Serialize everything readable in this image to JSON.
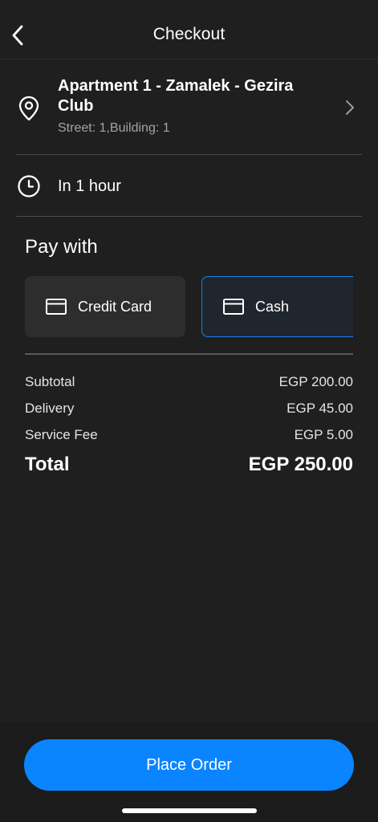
{
  "header": {
    "title": "Checkout",
    "back_icon": "chevron-left-icon"
  },
  "address": {
    "title": "Apartment 1 - Zamalek - Gezira Club",
    "subtitle": "Street: 1,Building: 1",
    "icon": "map-pin-icon",
    "action_icon": "chevron-right-icon"
  },
  "delivery_time": {
    "label": "In 1 hour",
    "icon": "clock-icon"
  },
  "payment": {
    "title": "Pay with",
    "options": [
      {
        "label": "Credit Card",
        "icon": "credit-card-icon",
        "selected": false
      },
      {
        "label": "Cash",
        "icon": "credit-card-icon",
        "selected": true
      }
    ]
  },
  "summary": {
    "rows": [
      {
        "label": "Subtotal",
        "value": "EGP 200.00"
      },
      {
        "label": "Delivery",
        "value": "EGP 45.00"
      },
      {
        "label": "Service Fee",
        "value": "EGP 5.00"
      }
    ],
    "total": {
      "label": "Total",
      "value": "EGP 250.00"
    }
  },
  "cta": {
    "label": "Place Order"
  },
  "colors": {
    "background": "#1f1f1f",
    "accent": "#0a84ff",
    "selected_border": "#1d7fe8",
    "secondary_text": "#a3a3a3"
  }
}
